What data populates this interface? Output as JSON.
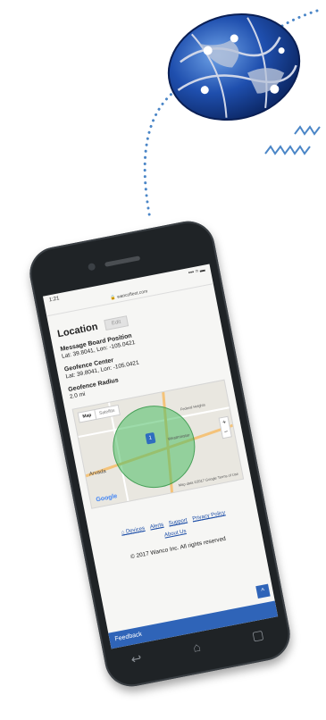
{
  "status_bar": {
    "time": "1:21",
    "signal": "▪▪▪ ≈ ▬"
  },
  "url_bar": {
    "url": "🔒 wancofleet.com"
  },
  "location": {
    "title": "Location",
    "edit_label": "Edit"
  },
  "fields": [
    {
      "label": "Message Board Position",
      "value": "Lat: 39.8041, Lon: -105.0421"
    },
    {
      "label": "Geofence Center",
      "value": "Lat: 39.8041, Lon: -105.0421"
    },
    {
      "label": "Geofence Radius",
      "value": "2.0 mi"
    }
  ],
  "map": {
    "toggle_map": "Map",
    "toggle_satellite": "Satellite",
    "pin_label": "1",
    "place_labels": [
      "Arvada",
      "Westminster",
      "Federal Heights"
    ],
    "google_logo": "Google",
    "attribution": "Map data ©2017 Google  Terms of Use",
    "zoom_in": "+",
    "zoom_out": "−"
  },
  "footer": {
    "links": [
      "⌂ Devices",
      "Alerts",
      "Support",
      "Privacy Policy"
    ],
    "about": "About Us",
    "copyright": "© 2017 Wanco Inc. All rights reserved",
    "up_button": "^",
    "feedback": "Feedback"
  },
  "nav_icons": {
    "back": "↩",
    "home": "⌂",
    "recent": "▢"
  },
  "colors": {
    "accent": "#2f64b8",
    "geofence": "#4cbe64",
    "globe": "#1a3f8f",
    "dots": "#4b86c7"
  }
}
